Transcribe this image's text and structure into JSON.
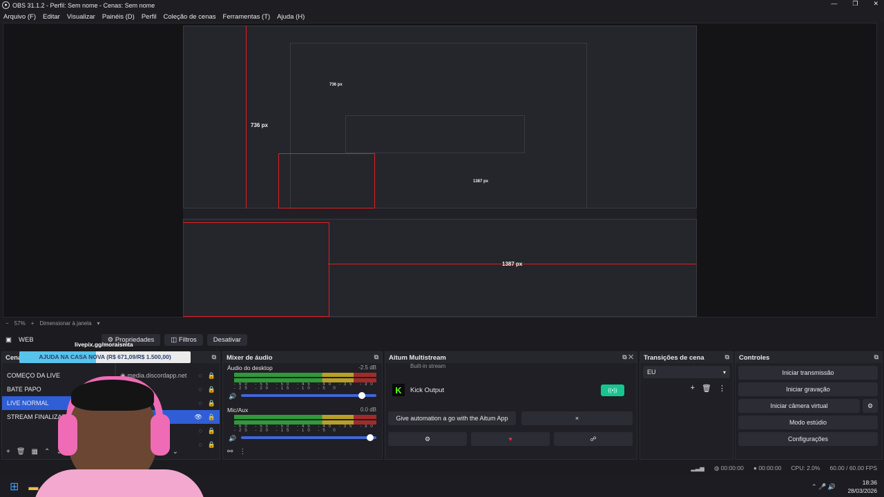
{
  "window": {
    "title": "OBS 31.1.2 - Perfil: Sem nome - Cenas: Sem nome",
    "controls": [
      "—",
      "❐",
      "✕"
    ]
  },
  "menu": [
    "Arquivo (F)",
    "Editar",
    "Visualizar",
    "Painéis (D)",
    "Perfil",
    "Coleção de cenas",
    "Ferramentas (T)",
    "Ajuda (H)"
  ],
  "preview": {
    "label_height": "736 px",
    "label_width": "1387 px",
    "nested_height": "736 px",
    "nested_width": "1387 px"
  },
  "zoom": {
    "percent": "57%",
    "plus": "+",
    "minus": "−",
    "mode": "Dimensionar à janela"
  },
  "source_bar": {
    "source_name": "WEB",
    "properties": "Propriedades",
    "filters": "Filtros",
    "deactivate": "Desativar"
  },
  "overlay": {
    "livepix": "livepix.gg/moraismta",
    "donation_text": "AJUDA NA CASA NOVA (R$ 671,09/R$ 1.500,00)",
    "donation_progress": 0.447
  },
  "scenes": {
    "title": "Cenas",
    "items": [
      "COMEÇO DA LIVE",
      "BATE PAPO",
      "LIVE NORMAL",
      "STREAM FINALIZADA"
    ],
    "active_index": 2
  },
  "sources": {
    "items": [
      "media.discordapp.net"
    ]
  },
  "mixer": {
    "title": "Mixer de áudio",
    "channels": [
      {
        "name": "Áudio do desktop",
        "db": "-2.5 dB"
      },
      {
        "name": "Mic/Aux",
        "db": "0.0 dB"
      }
    ],
    "scale": "-60 -55 -50 -45 -40 -35 -30 -25 -20 -15 -10 -5 0"
  },
  "aitum": {
    "title": "Aitum Multistream",
    "partial_row": "Built-in stream",
    "output_name": "Kick Output",
    "promo": "Give automation a go with the Aitum App",
    "close": "×"
  },
  "transitions": {
    "title": "Transições de cena",
    "selected": "EU"
  },
  "controls": {
    "title": "Controles",
    "buttons": [
      "Iniciar transmissão",
      "Iniciar gravação",
      "Iniciar câmera virtual",
      "Modo estúdio",
      "Configurações"
    ]
  },
  "status": {
    "rec_time": "00:00:00",
    "stream_time": "00:00:00",
    "cpu": "CPU: 2.0%",
    "fps": "60.00 / 60.00 FPS"
  },
  "taskbar": {
    "time": "18:36",
    "date": "28/03/2026"
  }
}
